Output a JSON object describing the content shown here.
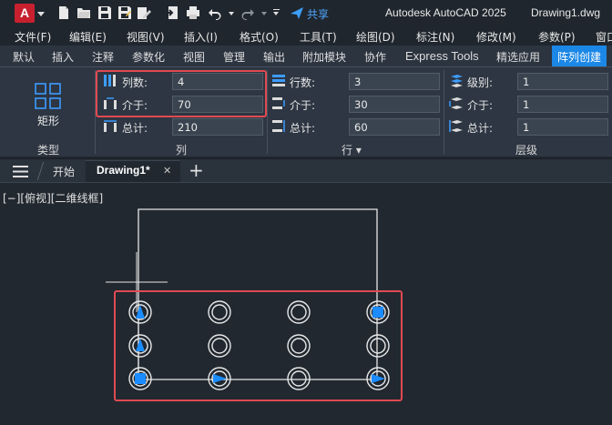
{
  "app": {
    "share_label": "共享",
    "product_title": "Autodesk AutoCAD 2025",
    "file_name": "Drawing1.dwg",
    "logo_letter": "A"
  },
  "menu": {
    "items": [
      "文件(F)",
      "编辑(E)",
      "视图(V)",
      "插入(I)",
      "格式(O)",
      "工具(T)",
      "绘图(D)",
      "标注(N)",
      "修改(M)",
      "参数(P)",
      "窗口"
    ]
  },
  "ribbon_tabs": {
    "items": [
      "默认",
      "插入",
      "注释",
      "参数化",
      "视图",
      "管理",
      "输出",
      "附加模块",
      "协作",
      "Express Tools",
      "精选应用",
      "阵列创建"
    ],
    "active_index": 11
  },
  "ribbon": {
    "type_panel": {
      "button_label": "矩形",
      "title": "类型"
    },
    "columns_panel": {
      "title": "列",
      "columns_label": "列数:",
      "columns_value": "4",
      "between_label": "介于:",
      "between_value": "70",
      "total_label": "总计:",
      "total_value": "210"
    },
    "rows_panel": {
      "title": "行 ▾",
      "rows_label": "行数:",
      "rows_value": "3",
      "between_label": "介于:",
      "between_value": "30",
      "total_label": "总计:",
      "total_value": "60"
    },
    "levels_panel": {
      "title": "层级",
      "levels_label": "级别:",
      "levels_value": "1",
      "between_label": "介于:",
      "between_value": "1",
      "total_label": "总计:",
      "total_value": "1"
    }
  },
  "doc_tabs": {
    "start_label": "开始",
    "drawing_label": "Drawing1*",
    "close_glyph": "✕",
    "add_glyph": "+"
  },
  "viewport": {
    "label": "[−][俯视][二维线框]"
  },
  "colors": {
    "accent": "#1b87e6",
    "highlight": "#e04a52",
    "grip": "#1a8cff"
  }
}
